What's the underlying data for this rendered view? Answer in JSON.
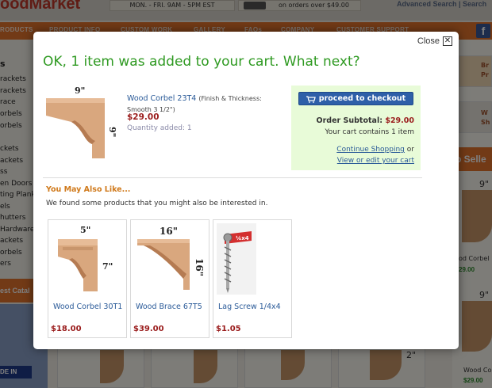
{
  "background": {
    "logo": "oodMarket",
    "hours": "MON. - FRI. 9AM - 5PM EST",
    "promo": "on orders over $49.00",
    "advanced_search": "Advanced Search | Search",
    "nav": [
      "RODUCTS",
      "PRODUCT INFO",
      "CUSTOM WORK",
      "GALLERY",
      "FAQs",
      "COMPANY",
      "CUSTOMER SUPPORT"
    ],
    "facebook": "f",
    "categories": [
      "s",
      "rackets",
      "rackets",
      "race",
      "orbels",
      "orbels",
      "ckets",
      "ackets",
      "ss",
      "en Doors",
      "ting Planks",
      "els",
      "hutters",
      "Hardware",
      "ackets",
      "orbels",
      "ers"
    ],
    "est_catalog": "est Catal",
    "made_in": "DE IN",
    "right_labels": [
      "Br",
      "Pr",
      "W",
      "Sh"
    ],
    "best_sellers": "p Selle",
    "right_dims": [
      "9\"",
      "9\""
    ],
    "right_names": [
      "od Corbel",
      "Wood Co"
    ],
    "right_prices": [
      "29.00",
      "$29.00"
    ],
    "bottom_dim": "2\""
  },
  "modal": {
    "close_label": "Close",
    "close_icon": "close-x-icon",
    "title": "OK, 1 item was added to your cart. What next?",
    "product": {
      "name": "Wood Corbel 23T4",
      "options": "(Finish & Thickness: Smooth 3 1/2\")",
      "price": "$29.00",
      "quantity": "Quantity added: 1",
      "dim_top": "9\"",
      "dim_side": "9\""
    },
    "cart": {
      "checkout_label": "proceed to checkout",
      "subtotal_label": "Order Subtotal:",
      "subtotal_value": "$29.00",
      "contains": "Your cart contains 1 item",
      "continue_shopping": "Continue Shopping",
      "or": "or",
      "view_edit": "View or edit your cart"
    },
    "also_heading": "You May Also Like...",
    "also_sub": "We found some products that you might also be interested in.",
    "suggestions": [
      {
        "name": "Wood Corbel 30T1",
        "price": "$18.00",
        "dim_top": "5\"",
        "dim_side": "7\""
      },
      {
        "name": "Wood Brace 67T5",
        "price": "$39.00",
        "dim_top": "16\"",
        "dim_side": "16\""
      },
      {
        "name": "Lag Screw 1/4x4",
        "price": "$1.05",
        "tag": "¼x4"
      }
    ]
  },
  "colors": {
    "title_green": "#2f9a22",
    "link_blue": "#2a5a98",
    "price_red": "#9a1c1c",
    "checkout_blue": "#2e5fa8",
    "cart_box_bg": "#e8fbd8",
    "nav_orange": "#e4742c",
    "heading_orange": "#d07a1c"
  }
}
